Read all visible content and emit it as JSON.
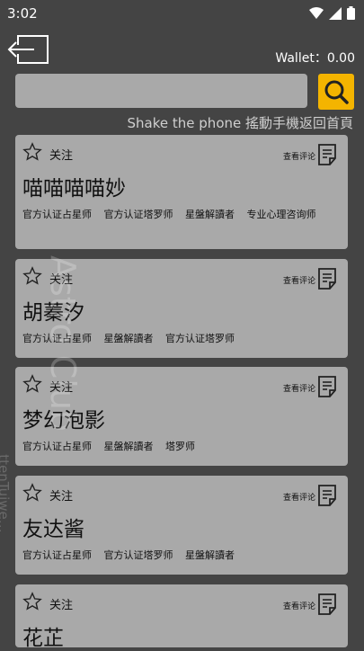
{
  "status": {
    "time": "3:02"
  },
  "header": {
    "wallet": "Wallet：0.00"
  },
  "search": {
    "placeholder": "",
    "hint": "Shake the phone 搖動手機返回首頁"
  },
  "watermark": {
    "main": "Astro Club",
    "sub": "ttenTuiwe…"
  },
  "cards": [
    {
      "follow_label": "关注",
      "review_label": "查看评论",
      "name": "喵喵喵喵妙",
      "tags": [
        "官方认证占星师",
        "官方认证塔罗师",
        "星盤解讀者",
        "专业心理咨询师"
      ]
    },
    {
      "follow_label": "关注",
      "review_label": "查看评论",
      "name": "胡蓁汐",
      "tags": [
        "官方认证占星师",
        "星盤解讀者",
        "官方认证塔罗师"
      ]
    },
    {
      "follow_label": "关注",
      "review_label": "查看评论",
      "name": "梦幻泡影",
      "tags": [
        "官方认证占星师",
        "星盤解讀者",
        "塔罗师"
      ]
    },
    {
      "follow_label": "关注",
      "review_label": "查看评论",
      "name": "友达酱",
      "tags": [
        "官方认证占星师",
        "官方认证塔罗师",
        "星盤解讀者"
      ]
    },
    {
      "follow_label": "关注",
      "review_label": "查看评论",
      "name": "花芷",
      "tags": []
    }
  ]
}
